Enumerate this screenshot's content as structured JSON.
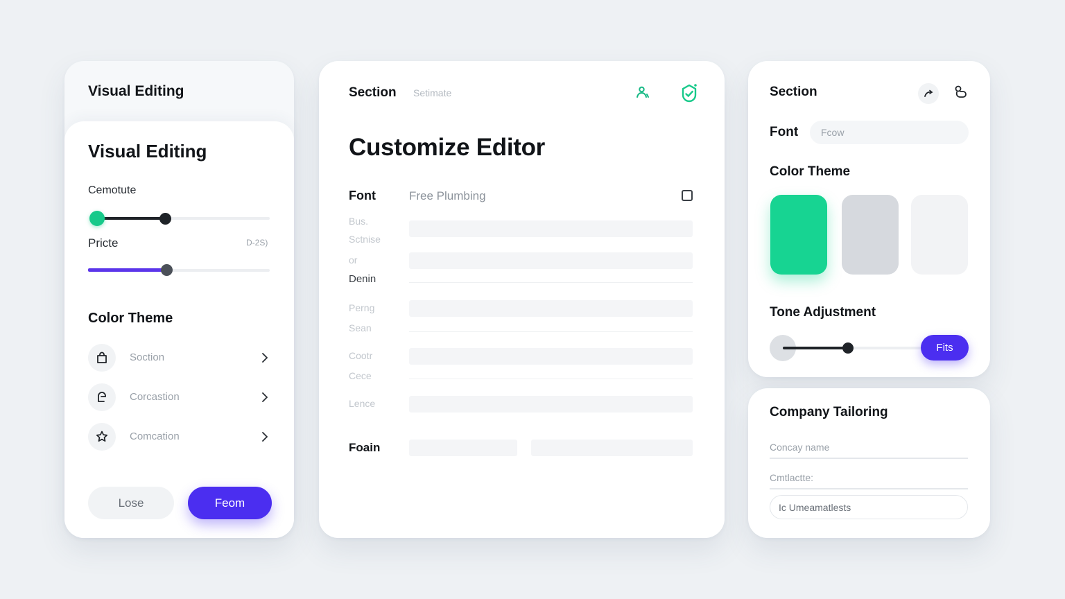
{
  "left_panel": {
    "back_title": "Visual Editing",
    "title": "Visual Editing",
    "slider1_label": "Cemotute",
    "slider1_value": 0.43,
    "slider2_label": "Pricte",
    "slider2_hint": "D-2S)",
    "slider2_value": 0.43,
    "color_theme_heading": "Color Theme",
    "items": [
      {
        "label": "Soction",
        "icon": "bag-icon"
      },
      {
        "label": "Corcastion",
        "icon": "profile-tag-icon"
      },
      {
        "label": "Comcation",
        "icon": "star-icon"
      }
    ],
    "secondary_button": "Lose",
    "primary_button": "Feom"
  },
  "center_panel": {
    "section_title": "Section",
    "section_sub": "Setimate",
    "heading": "Customize Editor",
    "font_label": "Font",
    "font_value": "Free Plumbing",
    "rows": {
      "r1": "Bus.",
      "r2": "Sctnise",
      "r3": "or",
      "r4": "Denin",
      "r5": "Perng",
      "r6": "Sean",
      "r7": "Cootr",
      "r8": "Cece",
      "r9": "Lence"
    },
    "footer_label": "Foain"
  },
  "right_top": {
    "section_title": "Section",
    "font_label": "Font",
    "font_placeholder": "Fcow",
    "color_theme_heading": "Color Theme",
    "swatches": [
      "#17d492",
      "#d6d9de",
      "#f2f3f5"
    ],
    "tone_heading": "Tone Adjustment",
    "tone_value": 0.48,
    "tone_button": "Fits"
  },
  "right_bottom": {
    "heading": "Company Tailoring",
    "field1_placeholder": "Concay name",
    "field2_placeholder": "Cmtlactte:",
    "field3_value": "Ic Umeamatlests"
  },
  "colors": {
    "accent_green": "#17c98a",
    "accent_purple": "#4b2ef0",
    "dark_knob": "#1f2328"
  }
}
